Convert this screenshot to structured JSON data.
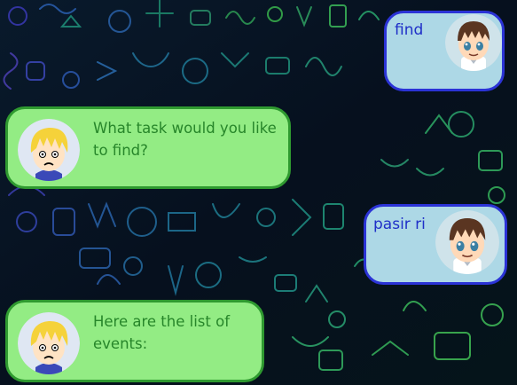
{
  "messages": [
    {
      "sender": "user",
      "text": "find",
      "avatar": "eren-avatar-icon"
    },
    {
      "sender": "bot",
      "text": "What task would you like\nto find?",
      "avatar": "blonde-worried-avatar-icon"
    },
    {
      "sender": "user",
      "text": "pasir ri",
      "avatar": "eren-avatar-icon"
    },
    {
      "sender": "bot",
      "text": "Here are the list of\nevents:",
      "avatar": "blonde-worried-avatar-icon"
    }
  ],
  "colors": {
    "background": "#06101e",
    "doodle_blue": "#1c4f92",
    "doodle_teal": "#1f8f7a",
    "doodle_green": "#37b24d",
    "doodle_purple": "#4b3fb3",
    "user_bubble": "#add8e6",
    "user_border": "#2b33d6",
    "user_text": "#1f2fc8",
    "bot_bubble": "#93ec84",
    "bot_border": "#2f9a30",
    "bot_text": "#27862a"
  }
}
